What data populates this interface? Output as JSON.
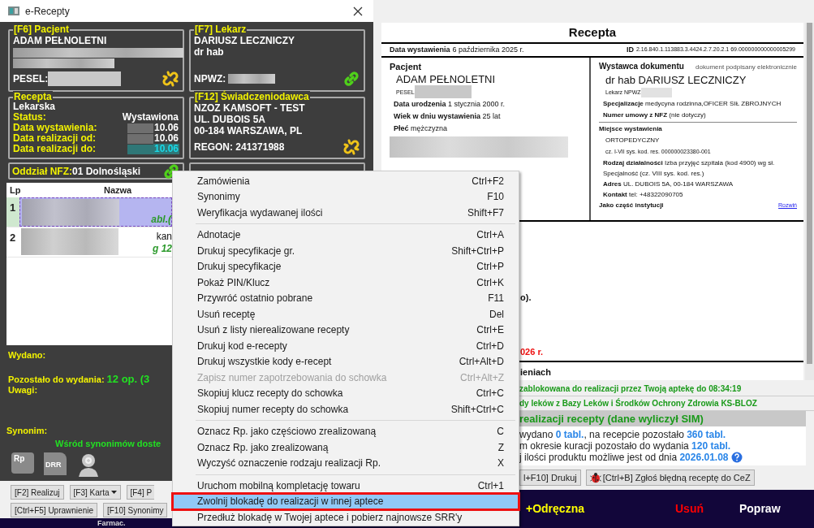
{
  "window": {
    "title": "e-Recepty"
  },
  "patient_box": {
    "title": "[F6] Pacjent",
    "name": "ADAM PEŁNOLETNI",
    "pesel_label": "PESEL:",
    "linked": false
  },
  "doctor_box": {
    "title": "[F7] Lekarz",
    "name": "DARIUSZ LECZNICZY",
    "degree": "dr hab",
    "npwz_label": "NPWZ:",
    "linked": true
  },
  "prescription_box": {
    "title": "Recepta",
    "type": "Lekarska",
    "fields": [
      {
        "label": "Status:",
        "value": "Wystawiona",
        "redacted": false,
        "highlight": false
      },
      {
        "label": "Data wystawienia:",
        "value": "10.06",
        "redacted": true,
        "highlight": false
      },
      {
        "label": "Data realizacji od:",
        "value": "10.06",
        "redacted": true,
        "highlight": false
      },
      {
        "label": "Data realizacji do:",
        "value": "10.06",
        "redacted": true,
        "highlight": true
      }
    ]
  },
  "provider_box": {
    "title": "[F12] Świadczeniodawca",
    "lines": [
      "NZOZ KAMSOFT - TEST",
      "UL. DUBOIS 5A",
      "00-184 WARSZAWA, PL"
    ],
    "regon": "REGON: 241371988",
    "linked": false
  },
  "nfz_box": {
    "label": "Oddział NFZ:",
    "value": "01 Dolnośląski",
    "linked": true
  },
  "drug_list": {
    "columns": [
      "Lp",
      "Nazwa"
    ],
    "rows": [
      {
        "lp": "1",
        "line_2": "abl.(",
        "selected": true
      },
      {
        "lp": "2",
        "line_1": "kan",
        "line_2": "g 12",
        "selected": false
      }
    ]
  },
  "details": {
    "issued_label": "Wydano:",
    "remaining_label": "Pozostało do wydania:",
    "remaining_value": "12 op. (3",
    "notes_label": "Uwagi:",
    "synonym_label": "Synonim:",
    "synonym_info": "Wśród synonimów doste"
  },
  "icon_buttons": [
    {
      "kind": "bubble",
      "label": "Rp"
    },
    {
      "kind": "document",
      "label": "DRR"
    },
    {
      "kind": "person"
    }
  ],
  "left_buttons": [
    [
      {
        "label": "[F2] Realizuj",
        "dropdown": false
      },
      {
        "label": "[F3] Karta",
        "dropdown": true
      },
      {
        "label": "[F4] P",
        "dropdown": false
      }
    ],
    [
      {
        "label": "[Ctrl+F5] Uprawnienie",
        "dropdown": false
      },
      {
        "label": "[F10] Synonimy",
        "dropdown": false
      }
    ]
  ],
  "left_footer": "Farmac.",
  "document": {
    "title": "Recepta",
    "issue_date_label": "Data wystawienia",
    "issue_date": "6 października 2025 r.",
    "id_label": "ID",
    "id": "2.16.840.1.113883.3.4424.2.7.20.2.1 69.000000000000005299",
    "patient": {
      "heading": "Pacjent",
      "name": "ADAM PEŁNOLETNI",
      "pesel_label": "PESEL",
      "fields": [
        {
          "label": "Data urodzenia",
          "value": "1 stycznia 2000 r."
        },
        {
          "label": "Wiek w dniu wystawienia",
          "value": "25 lat"
        },
        {
          "label": "Płeć",
          "value": "mężczyzna"
        }
      ]
    },
    "issuer": {
      "heading": "Wystawca dokumentu",
      "note": "dokument podpisany elektronicznie",
      "name": "dr hab DARIUSZ LECZNICZY",
      "npwz_label": "Lekarz NPWZ",
      "fields": [
        {
          "label": "Specjalizacje",
          "value": "medycyna rodzinna,OFICER SIŁ ZBROJNYCH"
        },
        {
          "label": "Numer umowy z NFZ",
          "value": "(nie dotyczy)"
        }
      ]
    },
    "place": {
      "heading": "Miejsce wystawienia",
      "name": "ORTOPEDYCZNY",
      "code": "cz. I-VII sys. kod. res. 000000023380-001",
      "fields": [
        {
          "label": "Rodzaj działalności",
          "value": "Izba przyjęć szpitala (kod 4900) wg sł. Specjalność (cz. VIII sys. kod. res.)"
        },
        {
          "label": "Adres",
          "value": "UL. DUBOIS 5A, 00-184 WARSZAWA"
        },
        {
          "label": "Kontakt",
          "value": "tel: +48322090705"
        }
      ]
    },
    "institution_label": "Jako część instytucji",
    "expand_link": "Rozwiń",
    "fragments": [
      {
        "text": "o).",
        "kind": "bold"
      },
      {
        "text": "026 r.",
        "kind": "warning"
      }
    ],
    "section_fragment": "ieniach"
  },
  "status_lines": [
    "zablokowana do realizacji przez Twoją aptekę do 08:34:19",
    "dy leków z Bazy Leków i Środków Ochrony Zdrowia KS-BLOZ"
  ],
  "calculation": {
    "title": "realizacji recepty (dane wyliczył SIM)",
    "lines": [
      "wydano **0 tabl.**, na recepcie pozostało **360 tabl.**",
      "m okresie kuracji pozostało do wydania **120 tabl.**",
      "j ilości produktu możliwe jest od dnia **2026.01.08**"
    ]
  },
  "right_buttons": [
    {
      "kind": "plain",
      "label": "l+F10] Drukuj"
    },
    {
      "kind": "bug",
      "label": "[Ctrl+B] Zgłoś błędną receptę do CeZ"
    }
  ],
  "bottom_bar": [
    {
      "label": "+Odręczna",
      "color": "#ffff00"
    },
    {
      "label": "Usuń",
      "color": "#ff0000"
    },
    {
      "label": "Popraw",
      "color": "#ffffff"
    }
  ],
  "context_menu": {
    "groups": [
      [
        {
          "label": "Zamówienia",
          "shortcut": "Ctrl+F2",
          "disabled": false,
          "selected": false
        },
        {
          "label": "Synonimy",
          "shortcut": "F10",
          "disabled": false,
          "selected": false
        },
        {
          "label": "Weryfikacja wydawanej ilości",
          "shortcut": "Shift+F7",
          "disabled": false,
          "selected": false
        }
      ],
      [
        {
          "label": "Adnotacje",
          "shortcut": "Ctrl+A",
          "disabled": false,
          "selected": false
        },
        {
          "label": "Drukuj specyfikacje gr.",
          "shortcut": "Shift+Ctrl+P",
          "disabled": false,
          "selected": false
        },
        {
          "label": "Drukuj specyfikacje",
          "shortcut": "Ctrl+P",
          "disabled": false,
          "selected": false
        },
        {
          "label": "Pokaż PIN/Klucz",
          "shortcut": "Ctrl+K",
          "disabled": false,
          "selected": false
        },
        {
          "label": "Przywróć ostatnio pobrane",
          "shortcut": "F11",
          "disabled": false,
          "selected": false
        },
        {
          "label": "Usuń receptę",
          "shortcut": "Del",
          "disabled": false,
          "selected": false
        },
        {
          "label": "Usuń z listy nierealizowane recepty",
          "shortcut": "Ctrl+E",
          "disabled": false,
          "selected": false
        },
        {
          "label": "Drukuj kod e-recepty",
          "shortcut": "Ctrl+D",
          "disabled": false,
          "selected": false
        },
        {
          "label": "Drukuj wszystkie kody e-recept",
          "shortcut": "Ctrl+Alt+D",
          "disabled": false,
          "selected": false
        },
        {
          "label": "Zapisz numer zapotrzebowania do schowka",
          "shortcut": "Ctrl+Alt+Z",
          "disabled": true,
          "selected": false
        },
        {
          "label": "Skopiuj klucz recepty do schowka",
          "shortcut": "Ctrl+C",
          "disabled": false,
          "selected": false
        },
        {
          "label": "Skopiuj numer recepty do schowka",
          "shortcut": "Shift+Ctrl+C",
          "disabled": false,
          "selected": false
        }
      ],
      [
        {
          "label": "Oznacz Rp. jako częściowo zrealizowaną",
          "shortcut": "C",
          "disabled": false,
          "selected": false
        },
        {
          "label": "Oznacz Rp. jako zrealizowaną",
          "shortcut": "Z",
          "disabled": false,
          "selected": false
        },
        {
          "label": "Wyczyść oznaczenie rodzaju realizacji Rp.",
          "shortcut": "X",
          "disabled": false,
          "selected": false
        }
      ],
      [
        {
          "label": "Uruchom mobilną kompletację towaru",
          "shortcut": "Ctrl+1",
          "disabled": false,
          "selected": false
        },
        {
          "label": "Zwolnij blokadę do realizacji w innej aptece",
          "disabled": false,
          "selected": true
        },
        {
          "label": "Przedłuż blokadę w Twojej aptece i pobierz najnowsze SRR'y",
          "disabled": false,
          "selected": false
        }
      ]
    ]
  }
}
